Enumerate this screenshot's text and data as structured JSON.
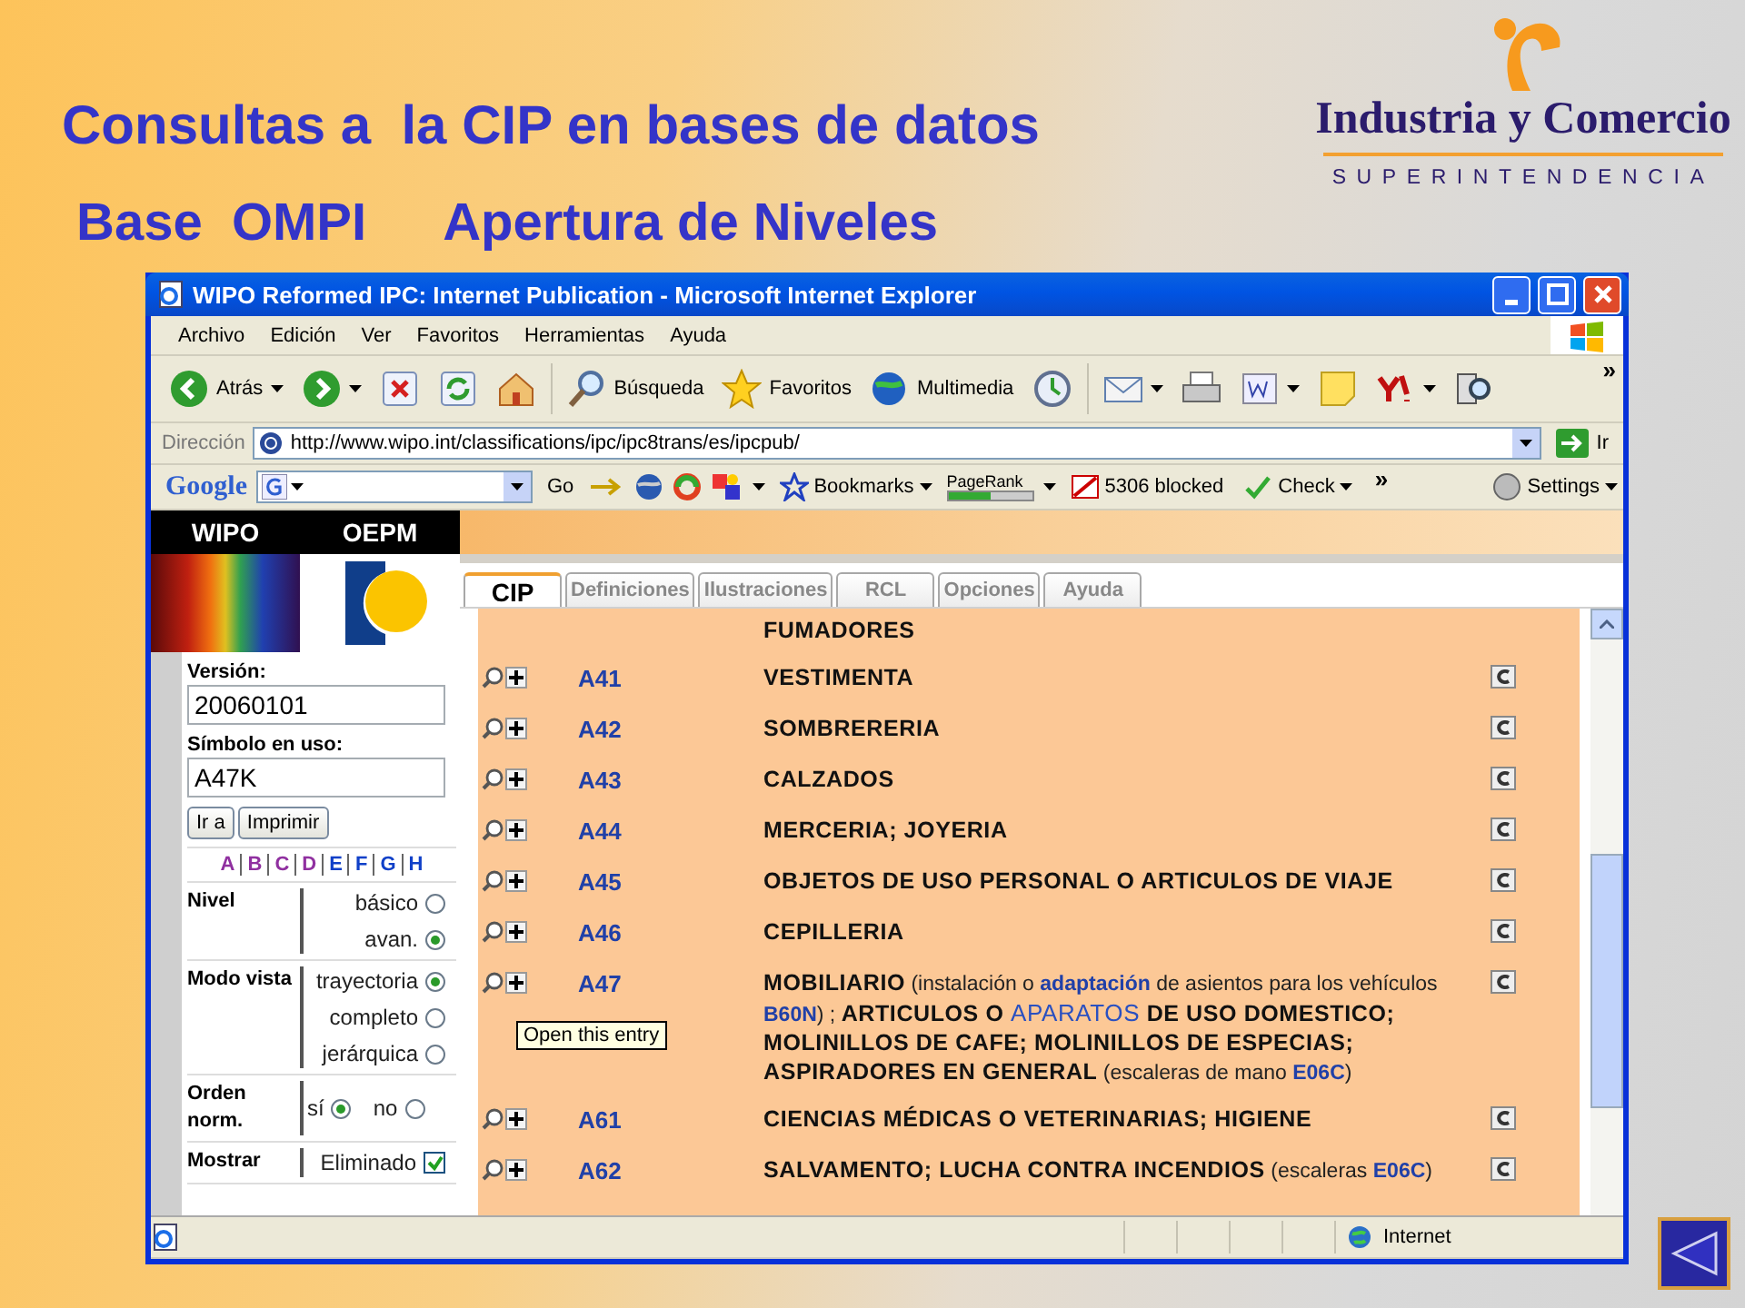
{
  "slide": {
    "title": "Consultas a  la CIP en bases de datos",
    "subtitle": [
      "Base  OMPI",
      "Apertura de Niveles"
    ]
  },
  "logo": {
    "name": "Industria y Comercio",
    "tagline": "SUPERINTENDENCIA"
  },
  "browser": {
    "title": "WIPO Reformed IPC: Internet Publication - Microsoft Internet Explorer",
    "menu": [
      "Archivo",
      "Edición",
      "Ver",
      "Favoritos",
      "Herramientas",
      "Ayuda"
    ],
    "toolbar": [
      {
        "kind": "back",
        "label": "Atrás",
        "dropdown": true
      },
      {
        "kind": "forward",
        "dropdown": true
      },
      {
        "kind": "stop"
      },
      {
        "kind": "refresh"
      },
      {
        "kind": "home"
      },
      {
        "kind": "search",
        "label": "Búsqueda"
      },
      {
        "kind": "favorites",
        "label": "Favoritos"
      },
      {
        "kind": "media",
        "label": "Multimedia"
      },
      {
        "kind": "history"
      },
      {
        "kind": "mail",
        "dropdown": true
      },
      {
        "kind": "print"
      },
      {
        "kind": "edit",
        "dropdown": true
      },
      {
        "kind": "note"
      },
      {
        "kind": "yahoo",
        "dropdown": true
      },
      {
        "kind": "research"
      }
    ],
    "toolbar_more": "»",
    "address": {
      "label": "Dirección",
      "url": "http://www.wipo.int/classifications/ipc/ipc8trans/es/ipcpub/",
      "go": "Ir"
    },
    "google_bar": {
      "brand": "Google",
      "go": "Go",
      "bookmarks": "Bookmarks",
      "pagerank": {
        "label": "PageRank",
        "level": 0.5
      },
      "blocked": "5306 blocked",
      "check": "Check",
      "more": "»",
      "settings": "Settings"
    },
    "status": {
      "zone": "Internet"
    }
  },
  "site": {
    "header": [
      "WIPO",
      "OEPM"
    ],
    "version": {
      "label": "Versión:",
      "value": "20060101"
    },
    "symbol": {
      "label": "Símbolo en uso:",
      "value": "A47K"
    },
    "buttons": [
      "Ir a",
      "Imprimir"
    ],
    "sections": [
      {
        "letter": "A",
        "visited": true
      },
      {
        "letter": "B",
        "visited": true
      },
      {
        "letter": "C",
        "visited": true
      },
      {
        "letter": "D",
        "visited": true
      },
      {
        "letter": "E",
        "visited": false
      },
      {
        "letter": "F",
        "visited": false
      },
      {
        "letter": "G",
        "visited": false
      },
      {
        "letter": "H",
        "visited": false
      }
    ],
    "options": [
      {
        "label": "Nivel",
        "kind": "radio",
        "choices": [
          {
            "label": "básico",
            "selected": false
          },
          {
            "label": "avan.",
            "selected": true
          }
        ]
      },
      {
        "label": "Modo vista",
        "kind": "radio",
        "choices": [
          {
            "label": "trayectoria",
            "selected": true
          },
          {
            "label": "completo",
            "selected": false
          },
          {
            "label": "jerárquica",
            "selected": false
          }
        ]
      },
      {
        "label": "Orden norm.",
        "kind": "radio-row",
        "choices": [
          {
            "label": "sí",
            "selected": true
          },
          {
            "label": "no",
            "selected": false
          }
        ]
      },
      {
        "label": "Mostrar",
        "kind": "checkbox",
        "choices": [
          {
            "label": "Eliminado",
            "checked": true
          }
        ]
      }
    ],
    "tabs": [
      {
        "label": "CIP",
        "selected": true
      },
      {
        "label": "Definiciones",
        "selected": false
      },
      {
        "label": "Ilustraciones",
        "selected": false
      },
      {
        "label": "RCL",
        "selected": false
      },
      {
        "label": "Opciones",
        "selected": false
      },
      {
        "label": "Ayuda",
        "selected": false
      }
    ],
    "entries": [
      {
        "kind": "continuation",
        "description": [
          {
            "kind": "bold",
            "text": "FUMADORES"
          }
        ]
      },
      {
        "kind": "entry",
        "code": "A41",
        "description": [
          {
            "kind": "bold",
            "text": "VESTIMENTA"
          }
        ]
      },
      {
        "kind": "entry",
        "code": "A42",
        "description": [
          {
            "kind": "bold",
            "text": "SOMBRERERIA"
          }
        ]
      },
      {
        "kind": "entry",
        "code": "A43",
        "description": [
          {
            "kind": "bold",
            "text": "CALZADOS"
          }
        ]
      },
      {
        "kind": "entry",
        "code": "A44",
        "description": [
          {
            "kind": "bold",
            "text": "MERCERIA; JOYERIA"
          }
        ]
      },
      {
        "kind": "entry",
        "code": "A45",
        "description": [
          {
            "kind": "bold",
            "text": "OBJETOS DE USO PERSONAL O ARTICULOS DE VIAJE"
          }
        ]
      },
      {
        "kind": "entry",
        "code": "A46",
        "description": [
          {
            "kind": "bold",
            "text": "CEPILLERIA"
          }
        ]
      },
      {
        "kind": "entry",
        "code": "A47",
        "description": [
          {
            "kind": "bold",
            "text": "MOBILIARIO"
          },
          {
            "kind": "plain",
            "text": " (instalación o "
          },
          {
            "kind": "link",
            "text": "adaptación"
          },
          {
            "kind": "plain",
            "text": " de asientos para los vehículos "
          },
          {
            "kind": "link",
            "text": "B60N"
          },
          {
            "kind": "plain",
            "text": ") ; "
          },
          {
            "kind": "bold",
            "text": "ARTICULOS O "
          },
          {
            "kind": "link-caps",
            "text": "APARATOS"
          },
          {
            "kind": "bold",
            "text": " DE USO DOMESTICO; MOLINILLOS DE CAFE; MOLINILLOS DE ESPECIAS; ASPIRADORES EN GENERAL"
          },
          {
            "kind": "plain",
            "text": " (escaleras de mano "
          },
          {
            "kind": "link",
            "text": "E06C"
          },
          {
            "kind": "plain",
            "text": ")"
          }
        ]
      },
      {
        "kind": "entry",
        "code": "A61",
        "description": [
          {
            "kind": "bold",
            "text": "CIENCIAS MÉDICAS O VETERINARIAS; HIGIENE"
          }
        ]
      },
      {
        "kind": "entry",
        "code": "A62",
        "description": [
          {
            "kind": "bold",
            "text": "SALVAMENTO; LUCHA CONTRA INCENDIOS"
          },
          {
            "kind": "plain",
            "text": " (escaleras "
          },
          {
            "kind": "link",
            "text": "E06C"
          },
          {
            "kind": "plain",
            "text": ")"
          }
        ]
      }
    ],
    "tooltip": "Open this entry"
  }
}
